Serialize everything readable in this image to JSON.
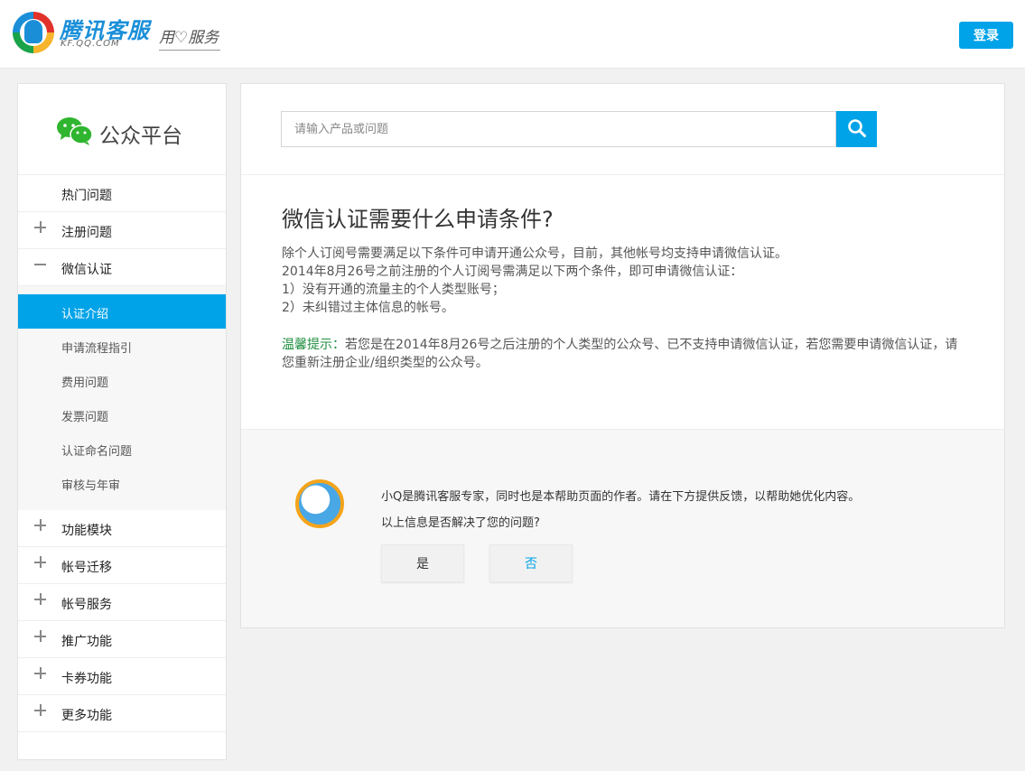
{
  "header": {
    "logo_title": "腾讯客服",
    "logo_sub": "KF.QQ.COM",
    "slogan": "用♡服务",
    "login_label": "登录"
  },
  "sidebar": {
    "title": "公众平台",
    "items": [
      {
        "label": "热门问题",
        "sign": "none"
      },
      {
        "label": "注册问题",
        "sign": "plus"
      },
      {
        "label": "微信认证",
        "sign": "minus"
      }
    ],
    "sub_items": [
      {
        "label": "认证介绍",
        "active": true
      },
      {
        "label": "申请流程指引",
        "active": false
      },
      {
        "label": "费用问题",
        "active": false
      },
      {
        "label": "发票问题",
        "active": false
      },
      {
        "label": "认证命名问题",
        "active": false
      },
      {
        "label": "审核与年审",
        "active": false
      }
    ],
    "items_after": [
      {
        "label": "功能模块",
        "sign": "plus"
      },
      {
        "label": "帐号迁移",
        "sign": "plus"
      },
      {
        "label": "帐号服务",
        "sign": "plus"
      },
      {
        "label": "推广功能",
        "sign": "plus"
      },
      {
        "label": "卡券功能",
        "sign": "plus"
      },
      {
        "label": "更多功能",
        "sign": "plus"
      }
    ]
  },
  "search": {
    "placeholder": "请输入产品或问题",
    "value": "",
    "icon": "search-icon"
  },
  "article": {
    "title": "微信认证需要什么申请条件?",
    "lines": [
      "除个人订阅号需要满足以下条件可申请开通公众号，目前，其他帐号均支持申请微信认证。",
      "2014年8月26号之前注册的个人订阅号需满足以下两个条件，即可申请微信认证：",
      "1）没有开通的流量主的个人类型账号；",
      "2）未纠错过主体信息的帐号。"
    ],
    "tip_label": "温馨提示：",
    "tip_text": "若您是在2014年8月26号之后注册的个人类型的公众号、已不支持申请微信认证，若您需要申请微信认证，请您重新注册企业/组织类型的公众号。"
  },
  "feedback": {
    "intro": "小Q是腾讯客服专家，同时也是本帮助页面的作者。请在下方提供反馈，以帮助她优化内容。",
    "question": "以上信息是否解决了您的问题?",
    "yes_label": "是",
    "no_label": "否"
  },
  "colors": {
    "accent": "#00a3e8",
    "tip_green": "#1e8e3e"
  }
}
